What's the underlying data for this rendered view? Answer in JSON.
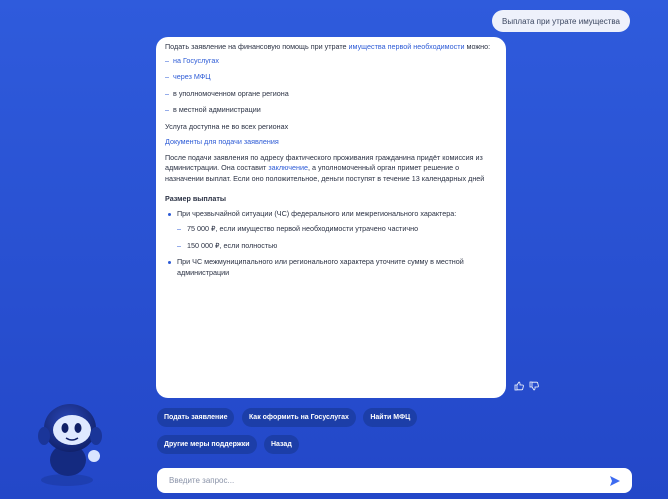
{
  "user_message": "Выплата при утрате имущества",
  "bot": {
    "intro_pre": "Подать заявление на финансовую помощь при утрате ",
    "intro_link": "имущества первой необходимости",
    "intro_post": " можно:",
    "ways": [
      {
        "text": "на Госуслугах",
        "link": true
      },
      {
        "text": "через МФЦ",
        "link": true
      },
      {
        "text": "в уполномоченном органе региона",
        "link": false
      },
      {
        "text": "в местной администрации",
        "link": false
      }
    ],
    "availability": "Услуга доступна не во всех регионах",
    "docs_link": "Документы для подачи заявления",
    "process_pre": "После подачи заявления по адресу фактического проживания гражданина придёт комиссия из администрации. Она составит ",
    "process_link": "заключение",
    "process_post": ", а уполномоченный орган примет решение о назначении выплат. Если оно положительное, деньги поступят в течение 13 календарных дней",
    "payment_heading": "Размер выплаты",
    "payment_item1": "При чрезвычайной ситуации (ЧС) федерального или межрегионального характера:",
    "payment_sub1": "75 000 ₽, если имущество первой необходимости утрачено частично",
    "payment_sub2": "150 000 ₽, если полностью",
    "payment_item2": "При ЧС межмуниципального или регионального характера уточните сумму в местной администрации"
  },
  "chips": [
    "Подать заявление",
    "Как оформить на Госуслугах",
    "Найти МФЦ",
    "Другие меры поддержки",
    "Назад"
  ],
  "input": {
    "placeholder": "Введите запрос..."
  },
  "colors": {
    "background": "#2a53d4",
    "chip": "#1c3ea8",
    "link": "#2d5bd6"
  }
}
